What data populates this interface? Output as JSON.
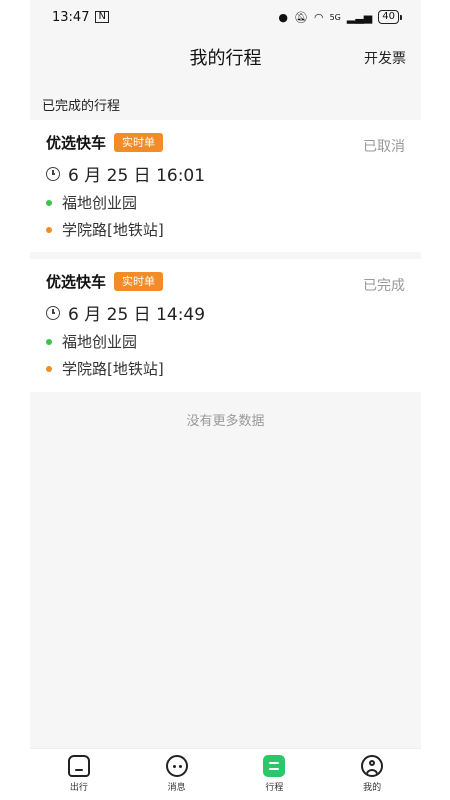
{
  "status_bar": {
    "time": "13:47",
    "nfc": "N",
    "signal_label": "5G",
    "battery": "40"
  },
  "header": {
    "title": "我的行程",
    "invoice": "开发票"
  },
  "section": {
    "completed_label": "已完成的行程"
  },
  "trips": [
    {
      "service": "优选快车",
      "badge": "实时单",
      "status": "已取消",
      "time": "6 月 25 日 16:01",
      "from": "福地创业园",
      "to": "学院路[地铁站]"
    },
    {
      "service": "优选快车",
      "badge": "实时单",
      "status": "已完成",
      "time": "6 月 25 日 14:49",
      "from": "福地创业园",
      "to": "学院路[地铁站]"
    }
  ],
  "footer_note": "没有更多数据",
  "tabs": [
    {
      "label": "出行",
      "icon": "home-icon"
    },
    {
      "label": "消息",
      "icon": "message-icon"
    },
    {
      "label": "行程",
      "icon": "trip-icon",
      "active": true
    },
    {
      "label": "我的",
      "icon": "profile-icon"
    }
  ],
  "colors": {
    "accent_orange": "#f28c28",
    "accent_green": "#2bc76a",
    "start_dot": "#3cc34a"
  }
}
